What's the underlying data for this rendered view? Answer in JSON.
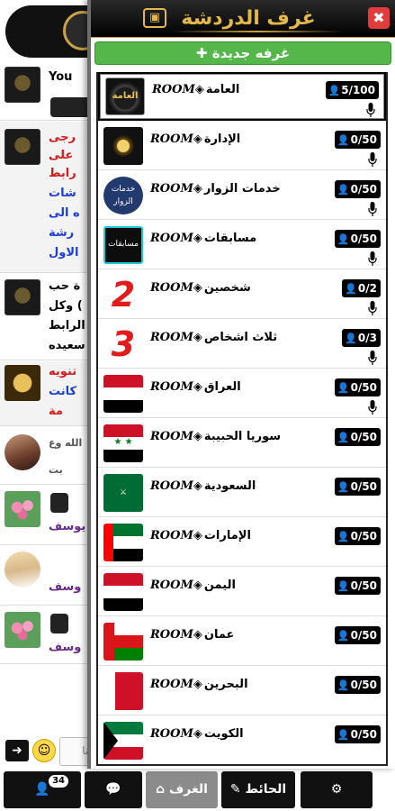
{
  "panel": {
    "title": "غرف الدردشة",
    "close_label": "✖",
    "new_room_label": "✚ غرفه جديدة"
  },
  "rooms": [
    {
      "room_word": "ROOM◈",
      "name": "العامة",
      "count": "5/100",
      "thumb": "main-logo",
      "thumb_text": "العامة",
      "mic": true
    },
    {
      "room_word": "ROOM◈",
      "name": "الإدارة",
      "count": "0/50",
      "thumb": "admin-emblem",
      "mic": true
    },
    {
      "room_word": "ROOM◈",
      "name": "خدمات الزوار",
      "count": "0/50",
      "thumb": "visitor-services",
      "thumb_text": "خدمات الزوار",
      "mic": true
    },
    {
      "room_word": "ROOM◈",
      "name": "مسابقات",
      "count": "0/50",
      "thumb": "competitions",
      "thumb_text": "مسابقات",
      "mic": true
    },
    {
      "room_word": "ROOM◈",
      "name": "شخصين",
      "count": "0/2",
      "thumb": "number-2",
      "thumb_text": "2",
      "mic": true
    },
    {
      "room_word": "ROOM◈",
      "name": "ثلاث اشخاص",
      "count": "0/3",
      "thumb": "number-3",
      "thumb_text": "3",
      "mic": true
    },
    {
      "room_word": "ROOM◈",
      "name": "العراق",
      "count": "0/50",
      "thumb": "iraq-flag",
      "mic": true
    },
    {
      "room_word": "ROOM◈",
      "name": "سوريا الحبيبة",
      "count": "0/50",
      "thumb": "syria-flag",
      "mic": false
    },
    {
      "room_word": "ROOM◈",
      "name": "السعودية",
      "count": "0/50",
      "thumb": "saudi-flag",
      "mic": false
    },
    {
      "room_word": "ROOM◈",
      "name": "الإمارات",
      "count": "0/50",
      "thumb": "uae-flag",
      "mic": false
    },
    {
      "room_word": "ROOM◈",
      "name": "اليمن",
      "count": "0/50",
      "thumb": "yemen-flag",
      "mic": false
    },
    {
      "room_word": "ROOM◈",
      "name": "عمان",
      "count": "0/50",
      "thumb": "oman-flag",
      "mic": false
    },
    {
      "room_word": "ROOM◈",
      "name": "البحرين",
      "count": "0/50",
      "thumb": "bahrain-flag",
      "mic": false
    },
    {
      "room_word": "ROOM◈",
      "name": "الكويت",
      "count": "0/50",
      "thumb": "kuwait-flag",
      "mic": false
    }
  ],
  "background_chat": {
    "header_text": "You",
    "messages": [
      {
        "text_lines": [
          "رجى",
          "على",
          "رابط",
          "شات",
          "ه الى",
          "رشة",
          "الاول"
        ],
        "colors": [
          "#d31b1b",
          "#d31b1b",
          "#d31b1b",
          "#1a3fd8",
          "#1a3fd8",
          "#1a3fd8",
          "#1a3fd8"
        ]
      },
      {
        "text_lines": [
          "ة حب",
          "وكل (",
          "الرابط",
          "سعيده"
        ],
        "colors": [
          "#000000",
          "#000000",
          "#000000",
          "#000000"
        ]
      },
      {
        "text_lines": [
          "تنويه",
          "كانت",
          "مة"
        ],
        "colors": [
          "#d31b1b",
          "#1a3fd8",
          "#d31b1b"
        ]
      },
      {
        "text_lines": [
          "الله وع",
          "بت"
        ],
        "colors": [
          "#555555",
          "#555555"
        ]
      },
      {
        "text_lines": [
          "يوسف"
        ],
        "colors": [
          "#6b2a8a"
        ]
      },
      {
        "text_lines": [
          "وسف"
        ],
        "colors": [
          "#6b2a8a"
        ]
      },
      {
        "text_lines": [
          "وسف"
        ],
        "colors": [
          "#6b2a8a"
        ]
      }
    ],
    "input_placeholder": "منا"
  },
  "bottom_nav": {
    "users_count": "34",
    "rooms_label": "الغرف",
    "wall_label": "الحائط"
  },
  "colors": {
    "accent_gold": "#e2b84a",
    "new_room_green": "#55b74a",
    "close_red": "#e23b3b"
  }
}
